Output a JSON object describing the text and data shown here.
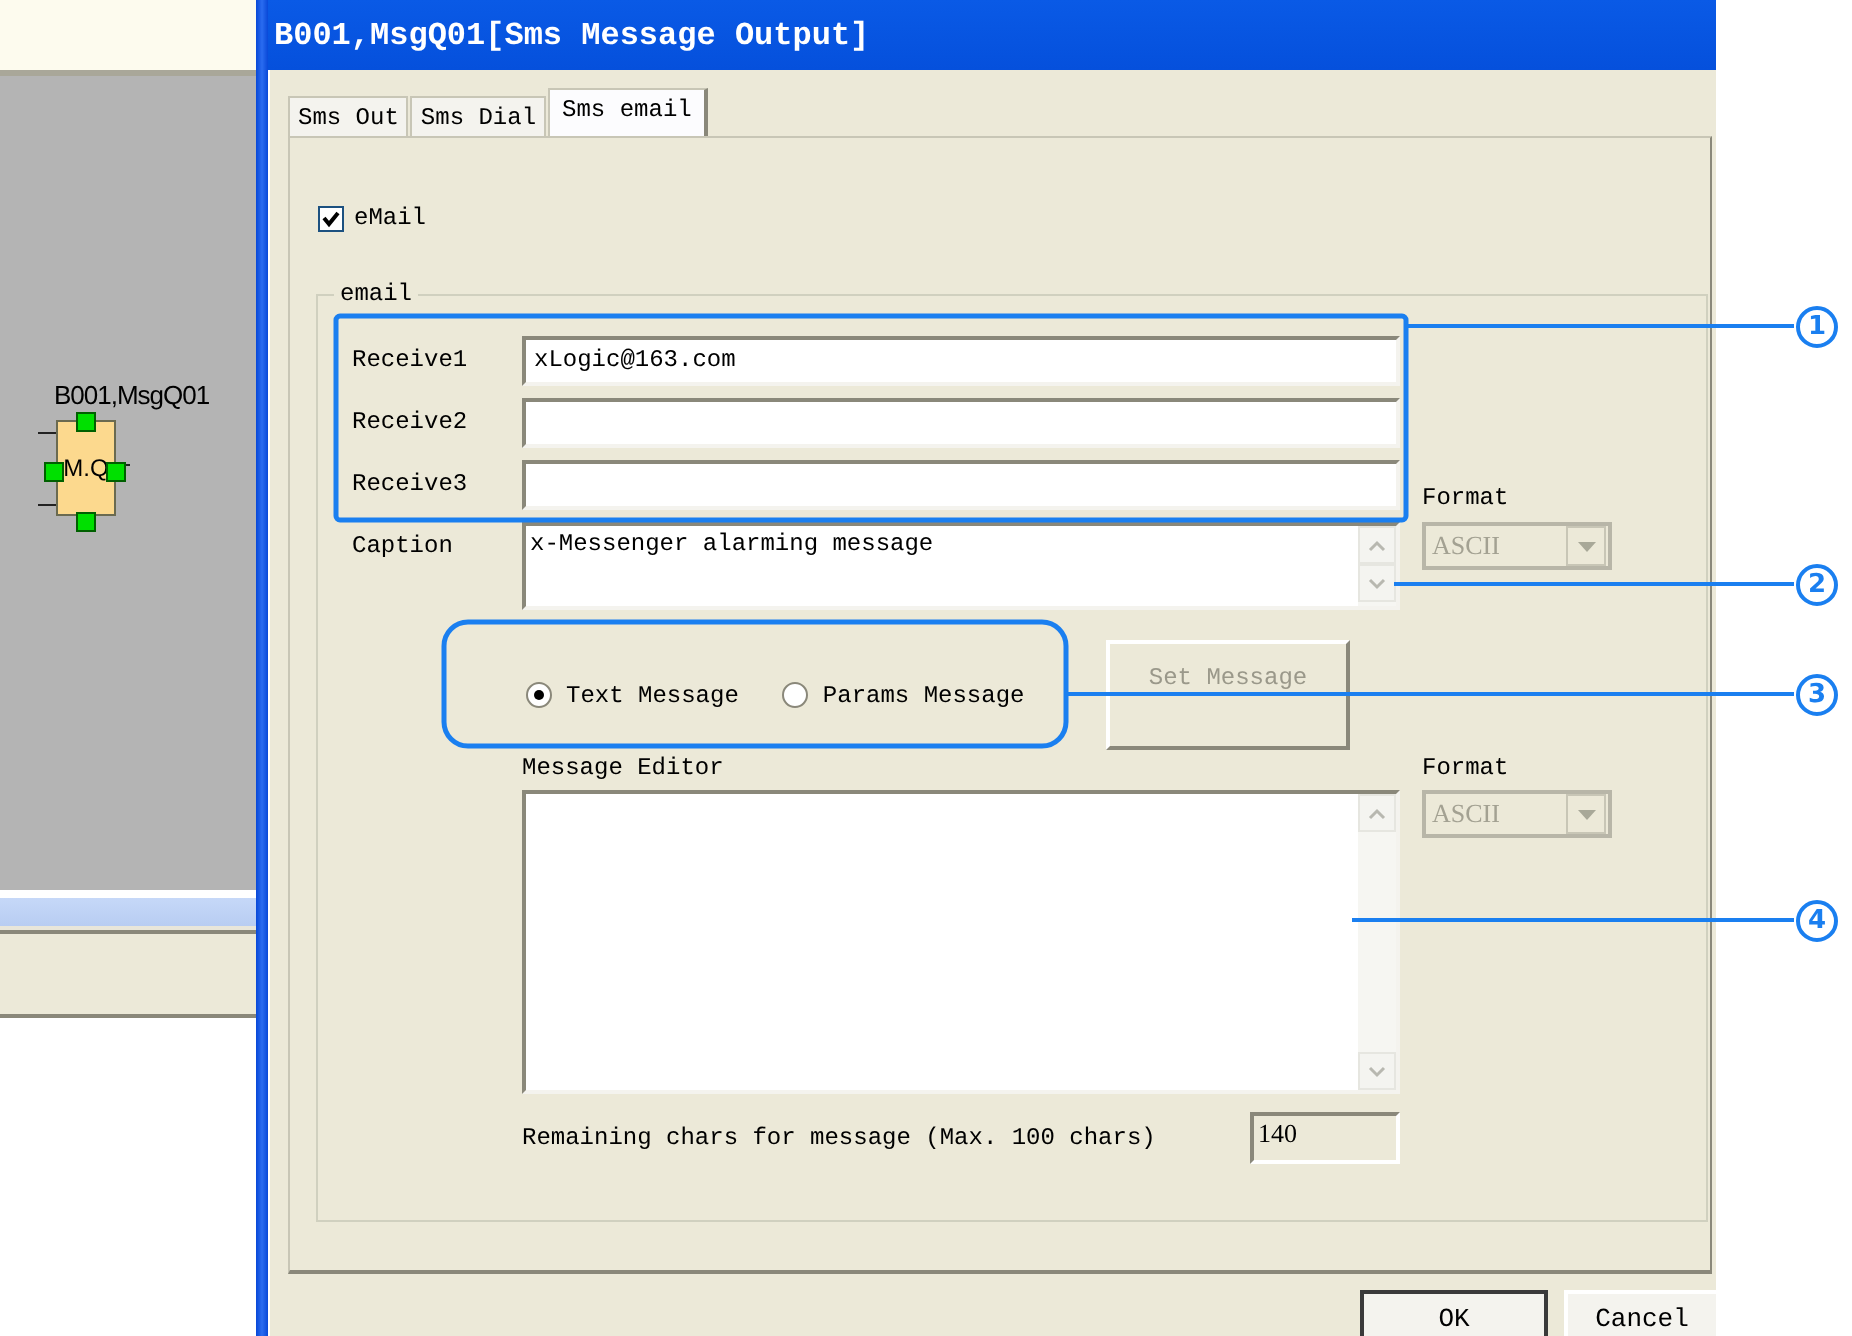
{
  "window": {
    "title": "B001,MsgQ01[Sms Message Output]"
  },
  "diagram_block": {
    "name": "B001,MsgQ01",
    "label": "M.Q"
  },
  "tabs": [
    {
      "label": "Sms Out",
      "selected": false
    },
    {
      "label": "Sms Dial",
      "selected": false
    },
    {
      "label": "Sms email",
      "selected": true
    }
  ],
  "email_enabled": {
    "label": "eMail",
    "checked": true
  },
  "email_group": {
    "title": "email",
    "receivers": [
      {
        "label": "Receive1",
        "value": "xLogic@163.com"
      },
      {
        "label": "Receive2"
      },
      {
        "label": "Receive3"
      }
    ],
    "caption": {
      "label": "Caption",
      "value": "x-Messenger alarming message"
    },
    "caption_format": {
      "label": "Format",
      "value": "ASCII",
      "disabled": true
    },
    "message_type": [
      {
        "label": "Text Message",
        "selected": true
      },
      {
        "label": "Params Message",
        "selected": false
      }
    ],
    "set_message_button": {
      "label": "Set Message",
      "disabled": true
    },
    "message_editor": {
      "label": "Message Editor"
    },
    "message_format": {
      "label": "Format",
      "value": "ASCII",
      "disabled": true
    },
    "remaining": {
      "label": "Remaining chars for message (Max. 100 chars)",
      "value": "140"
    }
  },
  "buttons": [
    {
      "label": "OK"
    },
    {
      "label": "Cancel"
    }
  ],
  "callouts": [
    {
      "number": "1",
      "framed": true
    },
    {
      "number": "2",
      "framed": false
    },
    {
      "number": "3",
      "framed": true
    },
    {
      "number": "4",
      "framed": false
    }
  ]
}
